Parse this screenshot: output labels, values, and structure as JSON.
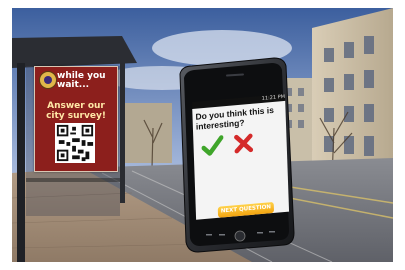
{
  "poster": {
    "line1": "while you wait...",
    "line2": "Answer our city survey!",
    "badge_icon": "city-seal-icon",
    "qr_icon": "qr-code-icon"
  },
  "phone": {
    "status_time": "11:21 PM",
    "question": "Do you think this is interesting?",
    "yes_icon": "green-checkmark-icon",
    "no_icon": "red-x-icon",
    "next_label": "NEXT QUESTION",
    "accent": "#f2a30f",
    "yes_color": "#3fa52a",
    "no_color": "#d42a2a"
  }
}
